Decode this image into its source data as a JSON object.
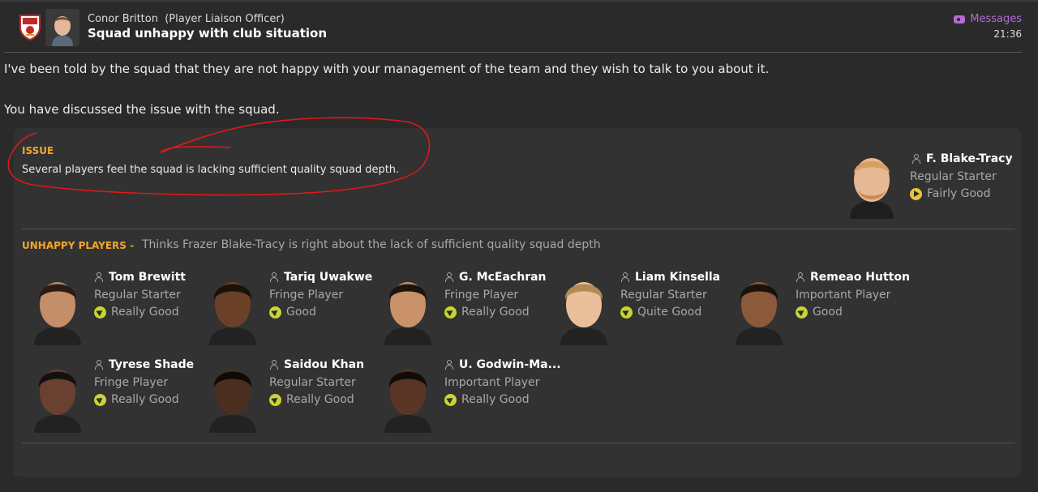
{
  "header": {
    "sender_name": "Conor Britton",
    "sender_role": "(Player Liaison Officer)",
    "subject": "Squad unhappy with club situation",
    "messages_label": "Messages",
    "time": "21:36"
  },
  "body": {
    "paragraph1": "I've been told by the squad that they are not happy with your management of the team and they wish to talk to you about it.",
    "paragraph2": "You have discussed the issue with the squad."
  },
  "issue": {
    "label": "ISSUE",
    "text": "Several players feel the squad is lacking sufficient quality squad depth."
  },
  "featured_player": {
    "name": "F. Blake-Tracy",
    "role": "Regular Starter",
    "rating": "Fairly Good"
  },
  "unhappy": {
    "label": "UNHAPPY PLAYERS -",
    "description": "Thinks Frazer Blake-Tracy is right about the lack of sufficient quality squad depth"
  },
  "players": [
    {
      "name": "Tom Brewitt",
      "role": "Regular Starter",
      "rating": "Really Good"
    },
    {
      "name": "Tariq Uwakwe",
      "role": "Fringe Player",
      "rating": "Good"
    },
    {
      "name": "G. McEachran",
      "role": "Fringe Player",
      "rating": "Really Good"
    },
    {
      "name": "Liam Kinsella",
      "role": "Regular Starter",
      "rating": "Quite Good"
    },
    {
      "name": "Remeao Hutton",
      "role": "Important Player",
      "rating": "Good"
    },
    {
      "name": "Tyrese Shade",
      "role": "Fringe Player",
      "rating": "Really Good"
    },
    {
      "name": "Saidou Khan",
      "role": "Regular Starter",
      "rating": "Really Good"
    },
    {
      "name": "U. Godwin-Ma...",
      "role": "Important Player",
      "rating": "Really Good"
    }
  ],
  "colors": {
    "accent_orange": "#f0a72b",
    "messages_purple": "#b56ad8",
    "rating_green": "#c8d433",
    "rating_yellow": "#e8c53a",
    "scribble_red": "#e01818"
  }
}
